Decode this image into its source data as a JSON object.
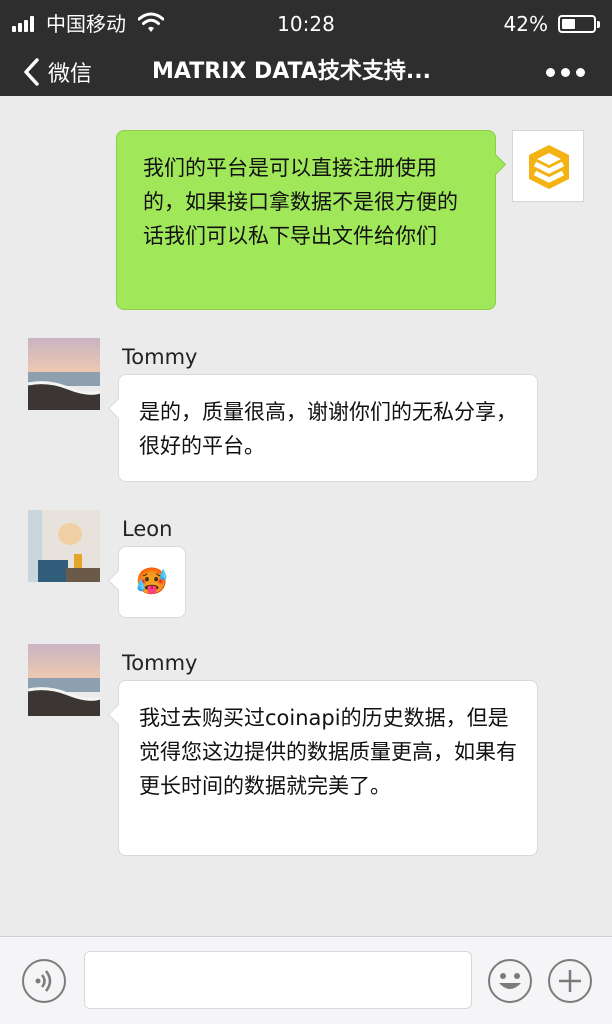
{
  "status_bar": {
    "carrier": "中国移动",
    "time": "10:28",
    "battery_text": "42%",
    "battery_level": 0.42,
    "signal_bars": 4,
    "icons": [
      "signal-icon",
      "wifi-icon",
      "battery-icon"
    ]
  },
  "nav": {
    "back_label": "微信",
    "title": "MATRIX DATA技术支持...",
    "icons": [
      "back-chevron-icon",
      "more-icon"
    ]
  },
  "messages": [
    {
      "sender": "self",
      "text": "我们的平台是可以直接注册使用的，如果接口拿数据不是很方便的话我们可以私下导出文件给你们",
      "avatar": "matrix-data-logo-icon"
    },
    {
      "sender": "Tommy",
      "name": "Tommy",
      "text": "是的，质量很高，谢谢你们的无私分享，很好的平台。",
      "avatar": "beach-sunset-avatar"
    },
    {
      "sender": "Leon",
      "name": "Leon",
      "text": "",
      "emoji": "🥵",
      "avatar": "room-lamp-avatar"
    },
    {
      "sender": "Tommy",
      "name": "Tommy",
      "text": "我过去购买过coinapi的历史数据，但是觉得您这边提供的数据质量更高，如果有更长时间的数据就完美了。",
      "avatar": "beach-sunset-avatar"
    }
  ],
  "input_bar": {
    "icons": [
      "voice-icon",
      "emoji-icon",
      "plus-icon"
    ],
    "value": ""
  },
  "colors": {
    "nav_background": "#2e2e2f",
    "chat_background": "#ebebeb",
    "outgoing_bubble": "#a0e75a",
    "incoming_bubble": "#ffffff",
    "logo_accent": "#f3b312"
  }
}
